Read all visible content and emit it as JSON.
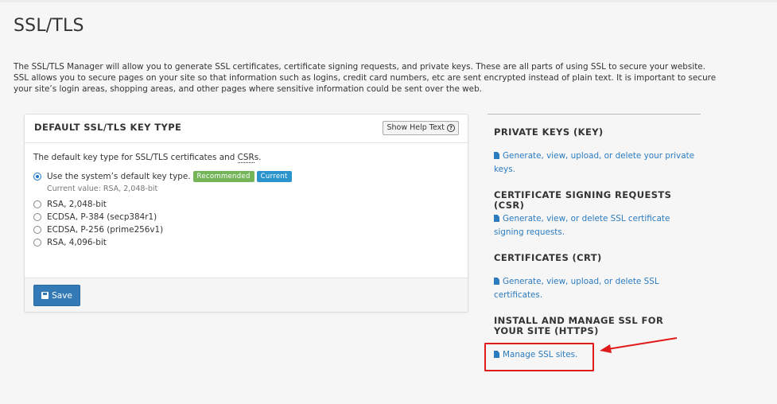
{
  "page": {
    "title": "SSL/TLS",
    "intro": "The SSL/TLS Manager will allow you to generate SSL certificates, certificate signing requests, and private keys. These are all parts of using SSL to secure your website. SSL allows you to secure pages on your site so that information such as logins, credit card numbers, etc are sent encrypted instead of plain text. It is important to secure your site’s login areas, shopping areas, and other pages where sensitive information could be sent over the web."
  },
  "panel": {
    "title": "DEFAULT SSL/TLS KEY TYPE",
    "help_button": "Show Help Text",
    "description_prefix": "The default key type for SSL/TLS certificates and ",
    "description_abbr": "CSR",
    "description_suffix": "s.",
    "options": [
      {
        "label": "Use the system’s default key type.",
        "checked": true,
        "badges": [
          "Recommended",
          "Current"
        ]
      },
      {
        "label": "RSA, 2,048-bit",
        "checked": false
      },
      {
        "label": "ECDSA, P-384 (secp384r1)",
        "checked": false
      },
      {
        "label": "ECDSA, P-256 (prime256v1)",
        "checked": false
      },
      {
        "label": "RSA, 4,096-bit",
        "checked": false
      }
    ],
    "current_value": "Current value: RSA, 2,048-bit",
    "save_label": "Save"
  },
  "sidebar": {
    "sections": [
      {
        "heading": "PRIVATE KEYS (KEY)",
        "link": "Generate, view, upload, or delete your private keys."
      },
      {
        "heading": "CERTIFICATE SIGNING REQUESTS (CSR)",
        "link": "Generate, view, or delete SSL certificate signing requests."
      },
      {
        "heading": "CERTIFICATES (CRT)",
        "link": "Generate, view, upload, or delete SSL certificates."
      },
      {
        "heading": "INSTALL AND MANAGE SSL FOR YOUR SITE (HTTPS)",
        "link": "Manage SSL sites."
      }
    ]
  },
  "colors": {
    "link": "#2b7bbf",
    "primary_button": "#337ab7",
    "badge_recommended": "#74b55a",
    "badge_current": "#2c94cc",
    "annotation": "#e01b1b"
  }
}
